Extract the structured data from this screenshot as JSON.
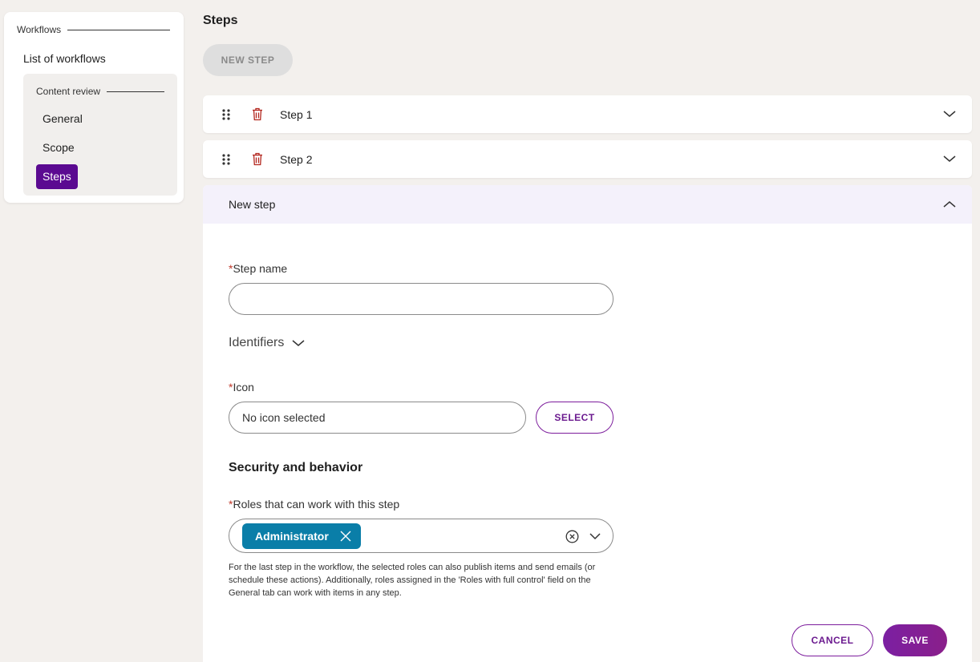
{
  "sidebar": {
    "section_heading": "Workflows",
    "list_link": "List of workflows",
    "workflow": {
      "heading": "Content review",
      "items": [
        {
          "label": "General",
          "active": false
        },
        {
          "label": "Scope",
          "active": false
        },
        {
          "label": "Steps",
          "active": true
        }
      ]
    }
  },
  "main": {
    "title": "Steps",
    "new_step_button": "NEW STEP",
    "steps": [
      {
        "label": "Step 1",
        "expanded": false
      },
      {
        "label": "Step 2",
        "expanded": false
      }
    ],
    "new_step_panel": {
      "title": "New step",
      "expanded": true,
      "step_name": {
        "required_mark": "*",
        "label": "Step name",
        "value": ""
      },
      "identifiers_label": "Identifiers",
      "icon": {
        "required_mark": "*",
        "label": "Icon",
        "placeholder": "No icon selected",
        "select_button": "SELECT"
      },
      "security_title": "Security and behavior",
      "roles": {
        "required_mark": "*",
        "label": "Roles that can work with this step",
        "selected": [
          "Administrator"
        ],
        "help_text": "For the last step in the workflow, the selected roles can also publish items and send emails (or schedule these actions). Additionally, roles assigned in the 'Roles with full control' field on the General tab can work with items in any step."
      },
      "cancel_button": "CANCEL",
      "save_button": "SAVE"
    }
  },
  "colors": {
    "accent": "#5b0a91",
    "chip": "#0a7ea8",
    "required": "#c0392b",
    "trash": "#b3261e"
  },
  "icons": [
    "drag-handle-icon",
    "trash-icon",
    "chevron-down-icon",
    "chevron-up-icon",
    "close-icon",
    "clear-circle-icon"
  ]
}
